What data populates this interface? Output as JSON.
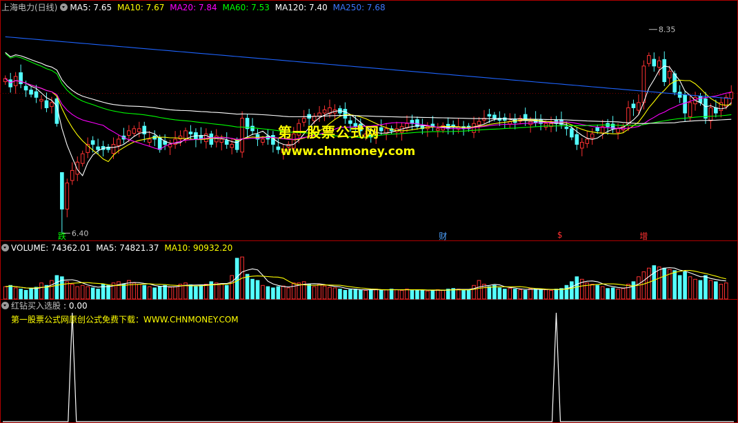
{
  "main_header": {
    "title": "上海电力(日线)",
    "ma5": "MA5: 7.65",
    "ma10": "MA10: 7.67",
    "ma20": "MA20: 7.84",
    "ma60": "MA60: 7.53",
    "ma120": "MA120: 7.40",
    "ma250": "MA250: 7.68"
  },
  "volume_header": {
    "volume": "VOLUME: 74362.01",
    "ma5": "MA5: 74821.37",
    "ma10": "MA10: 90932.20"
  },
  "indicator_header": {
    "name": "红钻买入选股",
    "value": ": 0.00",
    "note": "第一股票公式网原创公式免费下载：WWW.CHNMONEY.COM"
  },
  "watermark": {
    "line1": "第一股票公式网",
    "line2": "www.chnmoney.com"
  },
  "events": [
    {
      "label": "跌",
      "color": "#00ff00",
      "bar": 11
    },
    {
      "label": "财",
      "color": "#4fa3ff",
      "bar": 85
    },
    {
      "label": "$",
      "color": "#ff3030",
      "bar": 108
    },
    {
      "label": "增",
      "color": "#ff3030",
      "bar": 124
    }
  ],
  "colors": {
    "up": "#ff3232",
    "down": "#54ffff",
    "ma5": "#ffffff",
    "ma10": "#ffff00",
    "ma20": "#ff00ff",
    "ma60": "#00ff00",
    "ma120": "#ffffff",
    "ma250": "#1e64ff",
    "grid": "#800000",
    "axis": "#b00000"
  },
  "chart_data": {
    "type": "candlestick",
    "high_label": "8.35",
    "low_label": "6.40",
    "price_range": [
      6.35,
      8.5
    ],
    "close": [
      7.88,
      7.8,
      7.9,
      7.83,
      7.77,
      7.73,
      7.7,
      7.68,
      7.6,
      7.65,
      7.45,
      6.63,
      6.88,
      7.0,
      7.08,
      7.16,
      7.25,
      7.25,
      7.2,
      7.2,
      7.2,
      7.25,
      7.3,
      7.3,
      7.38,
      7.4,
      7.4,
      7.35,
      7.3,
      7.3,
      7.2,
      7.25,
      7.25,
      7.3,
      7.33,
      7.38,
      7.35,
      7.3,
      7.3,
      7.35,
      7.25,
      7.33,
      7.3,
      7.25,
      7.25,
      7.2,
      7.5,
      7.4,
      7.38,
      7.3,
      7.3,
      7.3,
      7.25,
      7.2,
      7.2,
      7.25,
      7.35,
      7.45,
      7.5,
      7.5,
      7.52,
      7.55,
      7.58,
      7.6,
      7.58,
      7.55,
      7.5,
      7.45,
      7.42,
      7.38,
      7.35,
      7.32,
      7.35,
      7.38,
      7.4,
      7.38,
      7.4,
      7.42,
      7.45,
      7.45,
      7.42,
      7.4,
      7.42,
      7.42,
      7.4,
      7.43,
      7.4,
      7.42,
      7.42,
      7.4,
      7.4,
      7.45,
      7.47,
      7.5,
      7.52,
      7.5,
      7.48,
      7.48,
      7.47,
      7.46,
      7.5,
      7.48,
      7.47,
      7.46,
      7.45,
      7.45,
      7.45,
      7.45,
      7.44,
      7.4,
      7.32,
      7.25,
      7.27,
      7.3,
      7.35,
      7.38,
      7.42,
      7.42,
      7.4,
      7.4,
      7.42,
      7.6,
      7.6,
      7.65,
      8.0,
      8.1,
      8.0,
      8.05,
      7.85,
      7.95,
      7.75,
      7.7,
      7.55,
      7.65,
      7.7,
      7.65,
      7.5,
      7.6,
      7.55,
      7.65,
      7.7,
      7.75
    ],
    "volume": [
      1.0,
      1.1,
      0.9,
      0.8,
      0.7,
      0.85,
      0.95,
      1.3,
      1.1,
      1.5,
      1.9,
      1.8,
      1.4,
      1.2,
      1.0,
      1.1,
      1.0,
      0.9,
      0.8,
      1.2,
      1.1,
      1.3,
      1.4,
      1.2,
      1.5,
      1.3,
      1.2,
      1.1,
      1.0,
      0.9,
      1.0,
      1.1,
      0.95,
      1.0,
      1.2,
      1.3,
      1.15,
      1.0,
      1.1,
      1.2,
      1.4,
      1.3,
      1.25,
      1.1,
      1.9,
      3.3,
      3.4,
      2.0,
      1.6,
      1.5,
      1.1,
      1.0,
      0.9,
      1.0,
      1.05,
      0.9,
      1.3,
      1.3,
      1.4,
      1.2,
      1.0,
      1.2,
      1.05,
      0.95,
      0.9,
      0.8,
      0.7,
      0.75,
      0.8,
      0.75,
      0.7,
      0.75,
      0.8,
      0.7,
      0.75,
      0.8,
      0.75,
      0.7,
      0.8,
      0.7,
      0.75,
      0.7,
      0.65,
      0.7,
      0.75,
      0.7,
      0.8,
      0.85,
      0.8,
      0.75,
      0.7,
      1.1,
      1.5,
      1.2,
      1.0,
      1.1,
      0.9,
      0.8,
      0.85,
      0.8,
      0.75,
      0.7,
      0.85,
      0.8,
      0.75,
      0.75,
      0.7,
      0.8,
      0.85,
      1.1,
      1.4,
      1.8,
      1.6,
      1.3,
      1.2,
      1.1,
      1.0,
      0.85,
      0.9,
      0.8,
      0.85,
      1.2,
      1.4,
      1.8,
      2.2,
      2.5,
      2.7,
      2.6,
      2.5,
      2.4,
      2.3,
      1.9,
      2.2,
      1.8,
      1.6,
      1.5,
      1.9,
      1.5,
      1.4,
      1.2,
      1.3
    ],
    "signal_spikes": [
      13,
      107
    ]
  }
}
